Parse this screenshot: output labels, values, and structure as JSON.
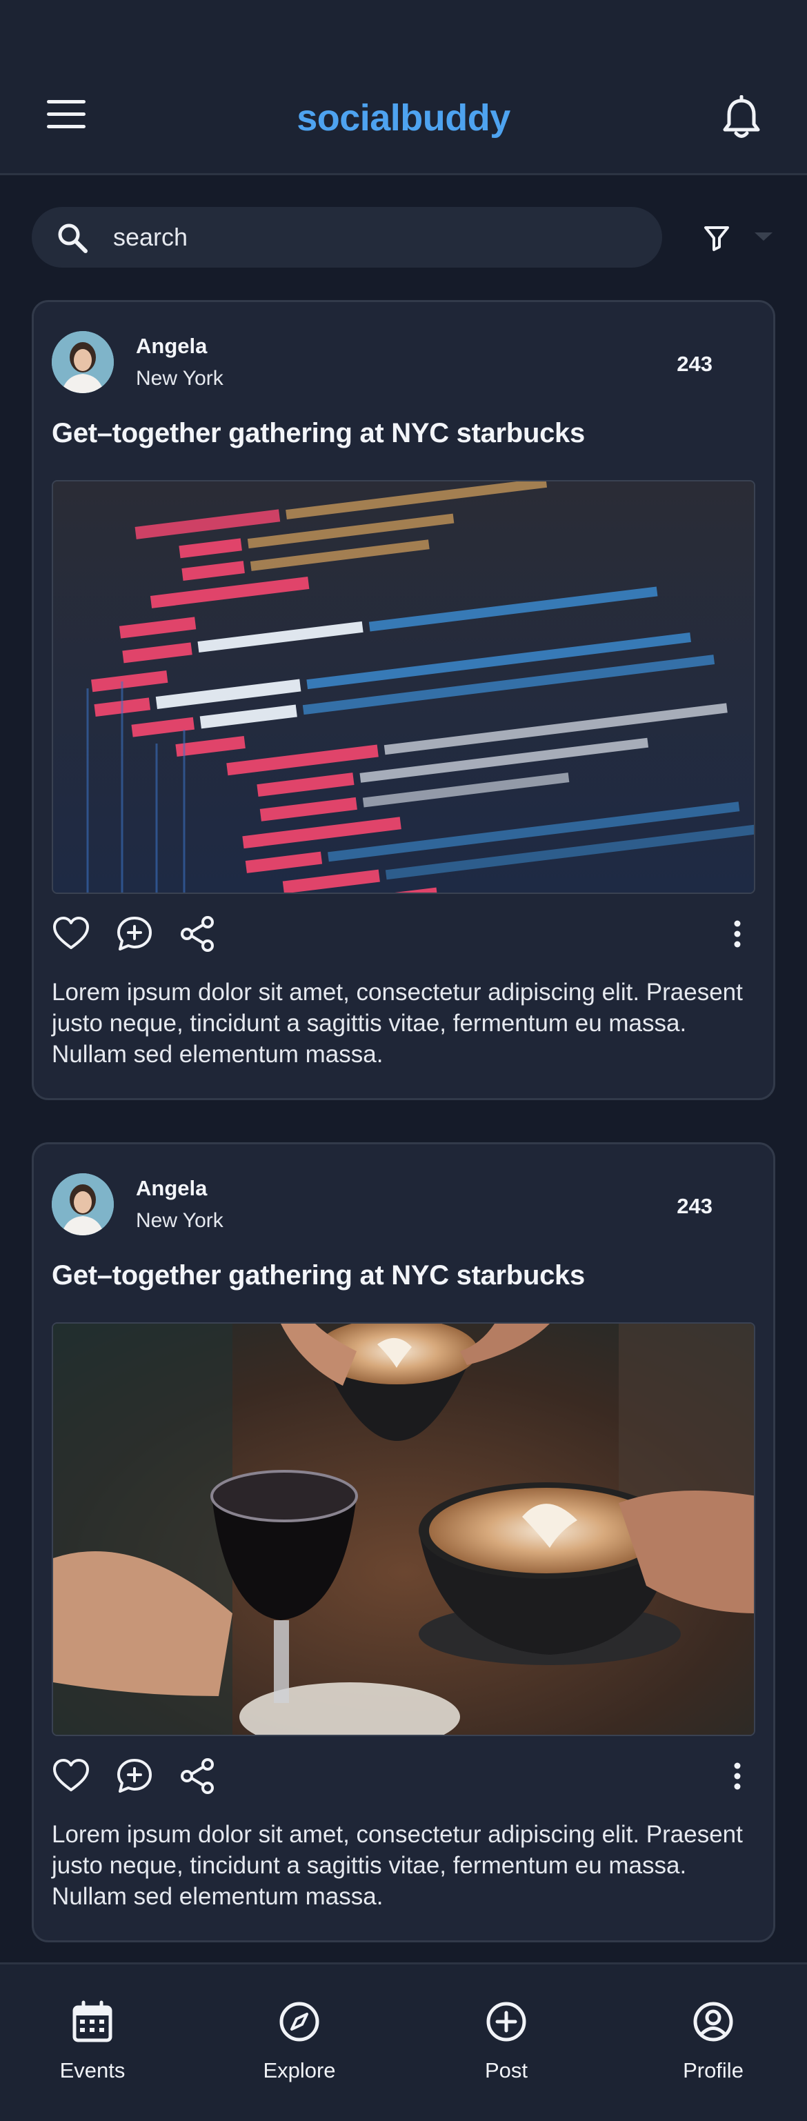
{
  "header": {
    "brand": "socialbuddy",
    "menu_icon": "hamburger-menu-icon",
    "notification_icon": "bell-icon"
  },
  "search": {
    "placeholder": "search",
    "icon": "search-icon",
    "filter_icon": "funnel-filter-icon",
    "filter_dropdown_icon": "caret-down-icon"
  },
  "posts": [
    {
      "author": "Angela",
      "location": "New York",
      "count": "243",
      "title": "Get–together gathering at NYC starbucks",
      "image": "code-editor-photo",
      "body": "Lorem ipsum dolor sit amet, consectetur adipiscing elit. Praesent justo neque, tincidunt a sagittis vitae, fermentum eu massa. Nullam sed elementum massa."
    },
    {
      "author": "Angela",
      "location": "New York",
      "count": "243",
      "title": "Get–together gathering at NYC starbucks",
      "image": "coffee-cheers-photo",
      "body": "Lorem ipsum dolor sit amet, consectetur adipiscing elit. Praesent justo neque, tincidunt a sagittis vitae, fermentum eu massa. Nullam sed elementum massa."
    }
  ],
  "nav": {
    "events": "Events",
    "explore": "Explore",
    "post": "Post",
    "profile": "Profile"
  },
  "colors": {
    "background": "#151b29",
    "surface": "#1f2637",
    "brand": "#4ea3f0",
    "text": "#e6e9ef"
  }
}
